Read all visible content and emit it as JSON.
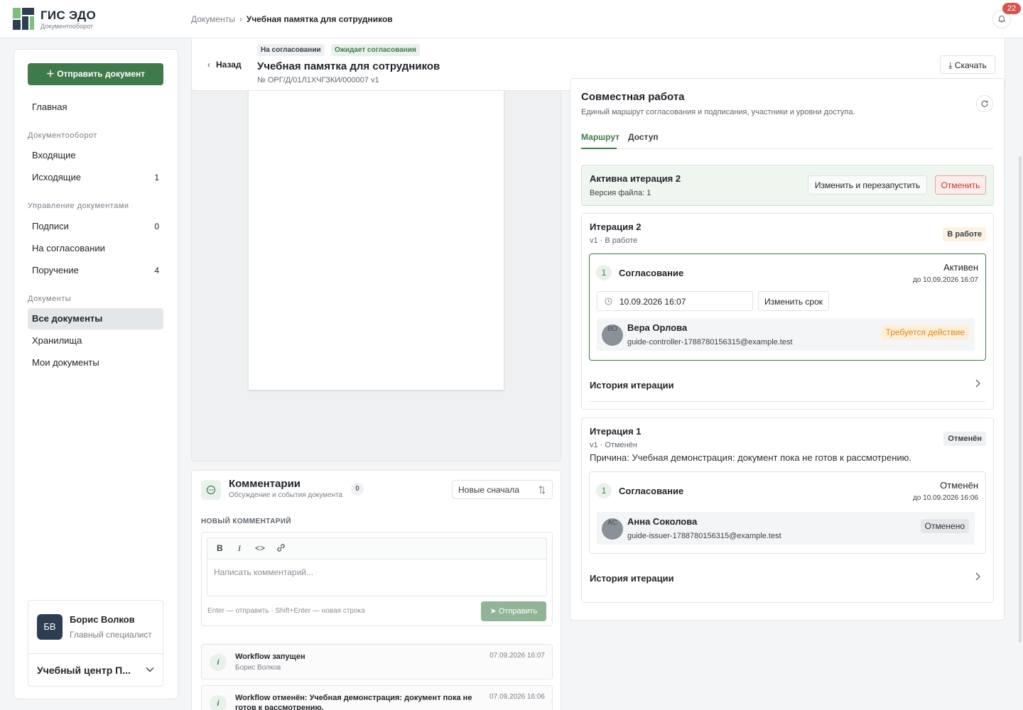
{
  "app": {
    "title": "ГИС ЭДО",
    "subtitle": "Документооборот"
  },
  "breadcrumb": {
    "root": "Документы",
    "separator": "›",
    "current": "Учебная памятка для сотрудников"
  },
  "notifications": {
    "count": "22"
  },
  "sidebar": {
    "send_label": "Отправить документ",
    "home": "Главная",
    "sec_docflow": "Документооборот",
    "incoming": "Входящие",
    "outgoing": "Исходящие",
    "outgoing_count": "1",
    "sec_manage": "Управление документами",
    "signatures": "Подписи",
    "signatures_count": "0",
    "approval": "На согласовании",
    "assignment": "Поручение",
    "assignment_count": "4",
    "sec_docs": "Документы",
    "all_docs": "Все документы",
    "storages": "Хранилища",
    "my_docs": "Мои документы",
    "user": {
      "initials": "БВ",
      "name": "Борис Волков",
      "role": "Главный специалист"
    },
    "org": "Учебный центр П..."
  },
  "doc": {
    "back": "Назад",
    "chip1": "На согласовании",
    "chip2": "Ожидает согласования",
    "title": "Учебная памятка для сотрудников",
    "number": "№ ОРГ/Д/01Л1ХЧГЗКИ/000007  v1",
    "download": "Скачать"
  },
  "comments": {
    "title": "Комментарии",
    "subtitle": "Обсуждение и события документа",
    "count": "0",
    "sort": "Новые сначала",
    "new_label": "НОВЫЙ КОММЕНТАРИЙ",
    "tb_bold": "B",
    "tb_italic": "I",
    "tb_code": "<>",
    "placeholder": "Написать комментарий...",
    "hint": "Enter — отправить · Shift+Enter — новая строка",
    "send": "Отправить",
    "events": [
      {
        "title": "Workflow запущен",
        "author": "Борис Волков",
        "date": "07.09.2026 16:07"
      },
      {
        "title": "Workflow отменён: Учебная демонстрация: документ пока не готов к рассмотрению.",
        "date": "07.09.2026 16:06"
      }
    ]
  },
  "collab": {
    "title": "Совместная работа",
    "subtitle": "Единый маршрут согласования и подписания, участники и уровни доступа.",
    "tab_route": "Маршрут",
    "tab_access": "Доступ",
    "active": {
      "title": "Активна итерация 2",
      "sub": "Версия файла: 1",
      "restart": "Изменить и перезапустить",
      "cancel": "Отменить"
    },
    "iter2": {
      "title": "Итерация 2",
      "sub": "v1 · В работе",
      "status": "В работе",
      "stage_num": "1",
      "stage_title": "Согласование",
      "stage_status": "Активен",
      "deadline": "до 10.09.2026 16:07",
      "date_value": "10.09.2026 16:07",
      "change_deadline": "Изменить срок",
      "participant": {
        "initials": "ВО",
        "name": "Вера Орлова",
        "email": "guide-controller-1788780156315@example.test",
        "badge": "Требуется действие"
      },
      "history": "История итерации"
    },
    "iter1": {
      "title": "Итерация 1",
      "sub": "v1 · Отменён",
      "status": "Отменён",
      "reason": "Причина: Учебная демонстрация: документ пока не готов к рассмотрению.",
      "stage_num": "1",
      "stage_title": "Согласование",
      "stage_status": "Отменён",
      "deadline": "до 10.09.2026 16:06",
      "participant": {
        "initials": "АС",
        "name": "Анна Соколова",
        "email": "guide-issuer-1788780156315@example.test",
        "badge": "Отменено"
      },
      "history": "История итерации"
    }
  },
  "colors": {
    "accent": "#3f7a4a",
    "danger": "#c0392b",
    "warning": "#e08a1e"
  }
}
